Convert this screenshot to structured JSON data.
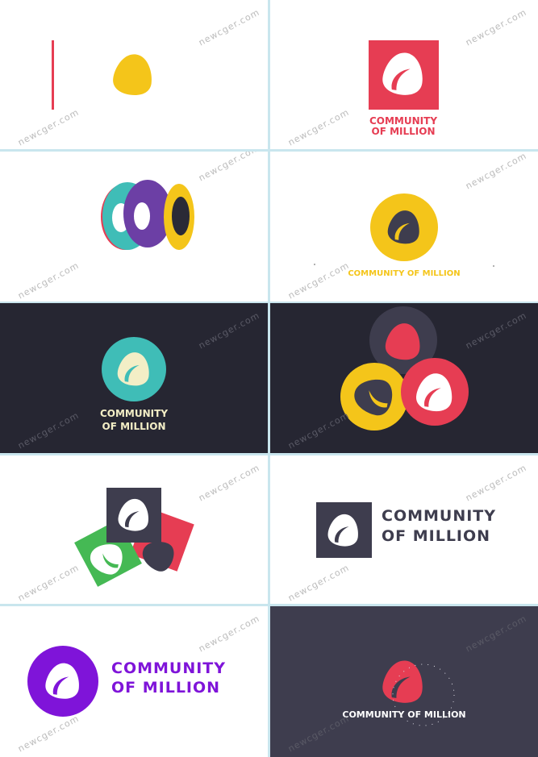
{
  "watermark": "newcger.com",
  "colors": {
    "red": "#e63d53",
    "yellow": "#f4c51a",
    "teal": "#3fbdb7",
    "purple": "#6c3fa5",
    "dark": "#2a2a36",
    "slate": "#3e3d4e",
    "green": "#45b954",
    "violet": "#7f14d9",
    "cream": "#f3eec6",
    "white": "#ffffff"
  },
  "panels": {
    "p2": {
      "line1": "COMMUNITY",
      "line2": "OF MILLION"
    },
    "p4": {
      "text": "COMMUNITY OF MILLION"
    },
    "p5": {
      "line1": "COMMUNITY",
      "line2": "OF MILLION"
    },
    "p8": {
      "line1": "COMMUNITY",
      "line2": "OF MILLION"
    },
    "p9": {
      "line1": "COMMUNITY",
      "line2": "OF MILLION"
    },
    "p10": {
      "text": "COMMUNITY OF MILLION"
    }
  }
}
